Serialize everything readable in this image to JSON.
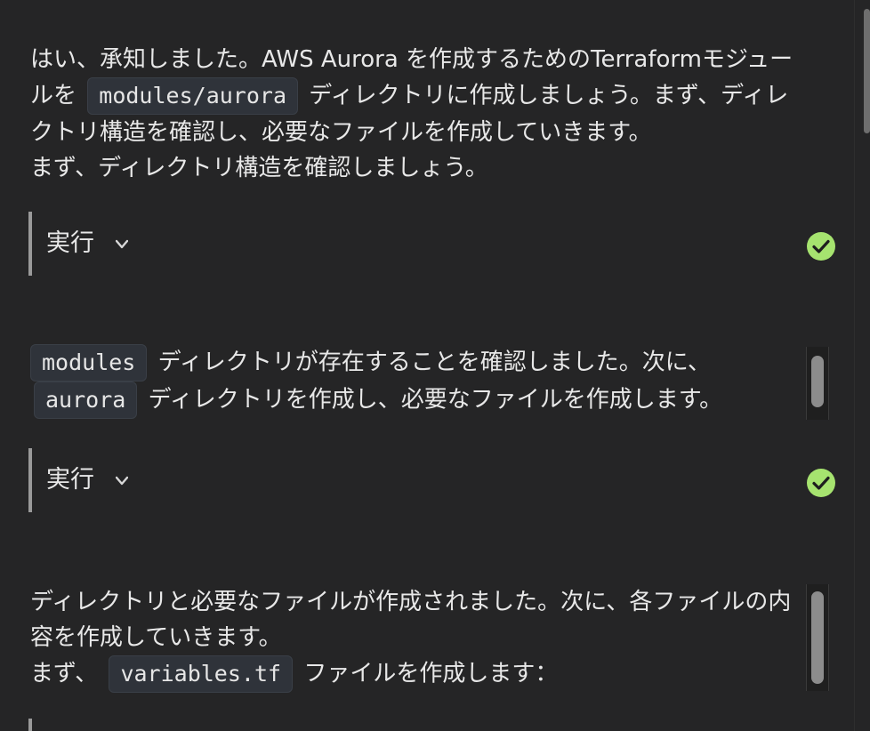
{
  "messages": [
    {
      "part1": "はい、承知しました。AWS Aurora を作成するためのTerraformモジュールを",
      "code": "modules/aurora",
      "part2": "ディレクトリに作成しましょう。まず、ディレクトリ構造を確認し、必要なファイルを作成していきます。",
      "line2": "まず、ディレクトリ構造を確認しましょう。"
    },
    {
      "code1": "modules",
      "part1": "ディレクトリが存在することを確認しました。次に、",
      "code2": "aurora",
      "part2": "ディレクトリを作成し、必要なファイルを作成します。"
    },
    {
      "line1": "ディレクトリと必要なファイルが作成されました。次に、各ファイルの内容を作成していきます。",
      "part1": "まず、",
      "code": "variables.tf",
      "part2": "ファイルを作成します："
    }
  ],
  "tool_blocks": [
    {
      "label": "実行",
      "icon": "chevron-down-icon",
      "status_icon": "check-circle-icon",
      "status_color": "#a6e36f"
    },
    {
      "label": "実行",
      "icon": "chevron-down-icon",
      "status_icon": "check-circle-icon",
      "status_color": "#a6e36f"
    }
  ]
}
